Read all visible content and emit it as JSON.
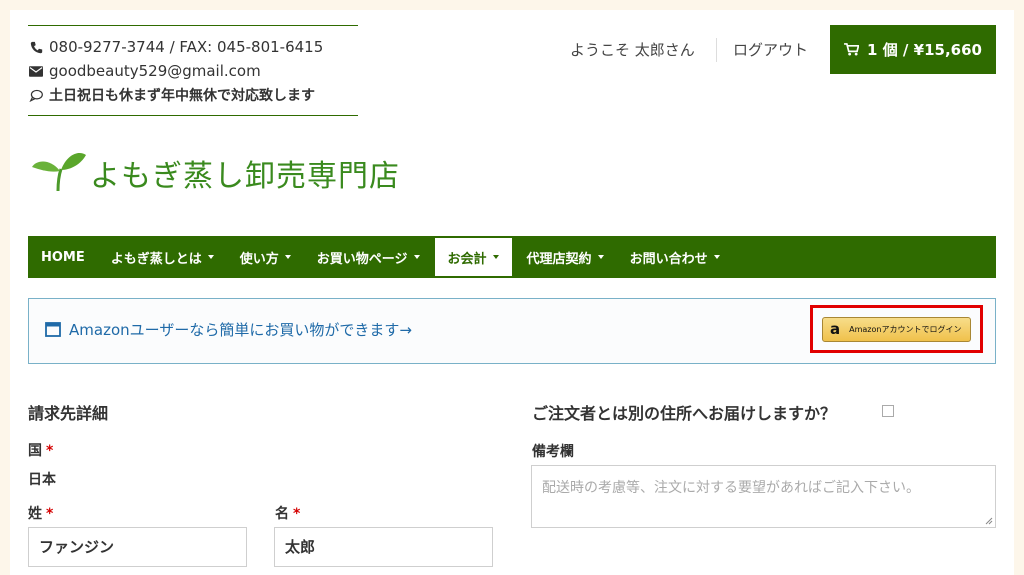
{
  "contact": {
    "phone": "080-9277-3744 / FAX: 045-801-6415",
    "email": "goodbeauty529@gmail.com",
    "hours": "土日祝日も休まず年中無休で対応致します"
  },
  "header": {
    "welcome": "ようこそ 太郎さん",
    "logout": "ログアウト",
    "cart": "1 個 / ¥15,660"
  },
  "logo": {
    "text": "よもぎ蒸し卸売専門店"
  },
  "nav": {
    "items": [
      {
        "label": "HOME"
      },
      {
        "label": "よもぎ蒸しとは"
      },
      {
        "label": "使い方"
      },
      {
        "label": "お買い物ページ"
      },
      {
        "label": "お会計"
      },
      {
        "label": "代理店契約"
      },
      {
        "label": "お問い合わせ"
      }
    ]
  },
  "amazon": {
    "banner_text": "Amazonユーザーなら簡単にお買い物ができます→",
    "logo": "a",
    "button_label": "Amazonアカウントでログイン"
  },
  "billing": {
    "title": "請求先詳細",
    "country_label": "国",
    "country_value": "日本",
    "last_name_label": "姓",
    "last_name_value": "ファンジン",
    "first_name_label": "名",
    "first_name_value": "太郎",
    "required_mark": "*"
  },
  "shipping": {
    "question": "ご注文者とは別の住所へお届けしますか？",
    "notes_label": "備考欄",
    "notes_placeholder": "配送時の考慮等、注文に対する要望があればご記入下さい。"
  },
  "colors": {
    "brand_green": "#2f6b00",
    "logo_green": "#3a8a1e",
    "link_blue": "#1f6aa8",
    "highlight_red": "#e10000",
    "required_red": "#d40000"
  }
}
